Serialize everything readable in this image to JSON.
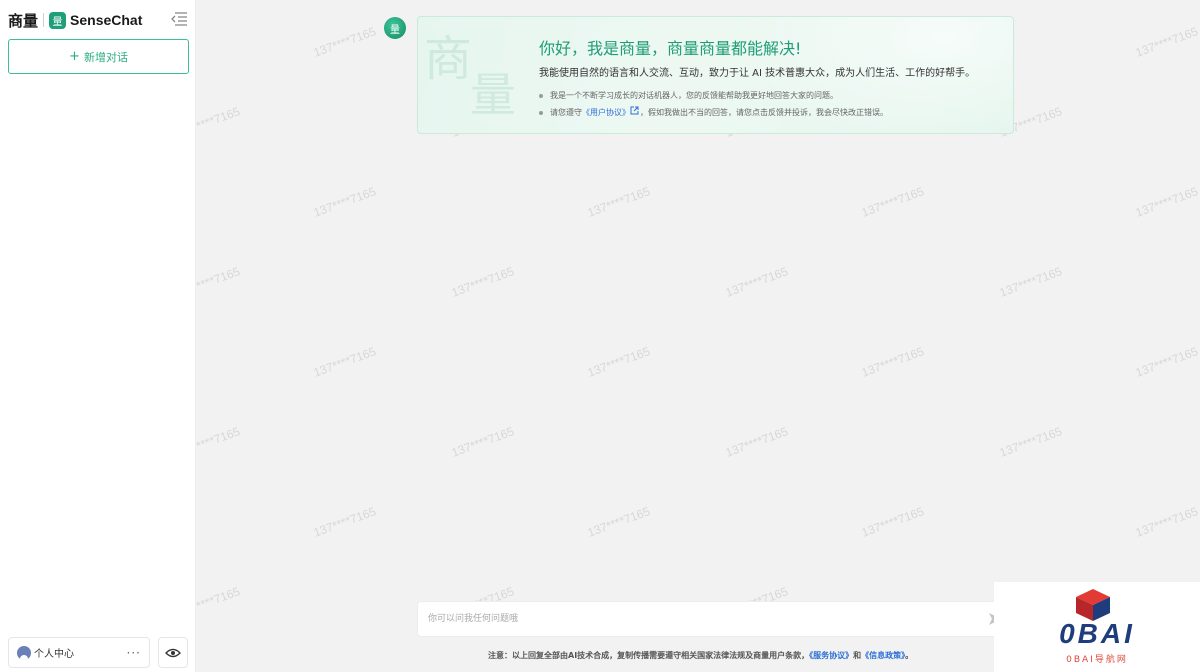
{
  "sidebar": {
    "brand_cn": "商量",
    "brand_en": "SenseChat",
    "logo_glyph": "量",
    "new_chat_label": "新增对话",
    "profile_label": "个人中心",
    "profile_more": "···",
    "icons": [
      "collapse-sidebar-icon",
      "plus-icon",
      "user-icon",
      "more-icon",
      "eye-icon"
    ]
  },
  "welcome": {
    "avatar_glyph": "量",
    "watermark_chars": [
      "商",
      "量"
    ],
    "title": "你好，我是商量，商量商量都能解决!",
    "subtitle": "我能使用自然的语言和人交流、互动，致力于让 AI 技术普惠大众，成为人们生活、工作的好帮手。",
    "bullet1": "我是一个不断学习成长的对话机器人，您的反馈能帮助我更好地回答大家的问题。",
    "bullet2_prefix": "请您遵守",
    "bullet2_link": "《用户协议》",
    "bullet2_suffix": "，假如我做出不当的回答，请您点击反馈并投诉，我会尽快改正错误。"
  },
  "input": {
    "placeholder": "你可以问我任何问题哦"
  },
  "footer": {
    "prefix": "注意：以上回复全部由AI技术合成，复制传播需要遵守相关国家法律法规及商量用户条款，",
    "link1": "《服务协议》",
    "and": "和",
    "link2": "《信息政策》",
    "suffix": "。"
  },
  "watermark_text": "137****7165",
  "badge": {
    "title": "0BAI",
    "subtitle": "0BAI导航网"
  },
  "colors": {
    "accent": "#2aad83",
    "link": "#2d6fd6",
    "badge_blue": "#1f3c7c",
    "badge_red": "#e0473a"
  }
}
